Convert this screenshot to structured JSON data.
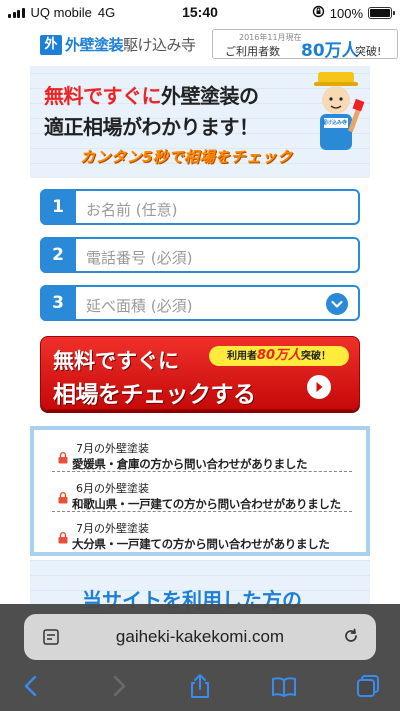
{
  "status": {
    "carrier": "UQ mobile",
    "network": "4G",
    "time": "15:40",
    "battery": "100%",
    "battery_level": 1.0,
    "signal_bars": 4
  },
  "header": {
    "logo_mark": "外",
    "logo_blue": "外壁塗装",
    "logo_grey": "駆け込み寺",
    "users_date": "2016年11月現在",
    "users_label": "ご利用者数",
    "users_count": "80万人",
    "users_suffix": "突破!"
  },
  "hero": {
    "title_red": "無料ですぐに",
    "title_dark": "外壁塗装の",
    "subtitle": "適正相場がわかります！",
    "cta": "カンタン5秒で相場をチェック",
    "mascot_label": "駆け込み寺"
  },
  "form": {
    "fields": [
      {
        "num": "1",
        "placeholder": "お名前 (任意)"
      },
      {
        "num": "2",
        "placeholder": "電話番号 (必須)"
      },
      {
        "num": "3",
        "placeholder": "延べ面積 (必須)"
      }
    ]
  },
  "cta_button": {
    "line1": "無料ですぐに",
    "line2": "相場をチェックする",
    "badge_prefix": "利用者",
    "badge_count": "80万人",
    "badge_suffix": "突破！"
  },
  "inquiries": [
    {
      "month": "7月の外壁塗装",
      "message": "愛媛県・倉庫の方から問い合わせがありました"
    },
    {
      "month": "6月の外壁塗装",
      "message": "和歌山県・一戸建ての方から問い合わせがありました"
    },
    {
      "month": "7月の外壁塗装",
      "message": "大分県・一戸建ての方から問い合わせがありました"
    }
  ],
  "section": {
    "title": "当サイトを利用した方の"
  },
  "browser": {
    "url": "gaiheki-kakekomi.com"
  },
  "colors": {
    "accent_blue": "#2a8ad8",
    "cta_red": "#d81c16",
    "highlight_red": "#e22222",
    "cta_orange": "#ff8a00"
  }
}
